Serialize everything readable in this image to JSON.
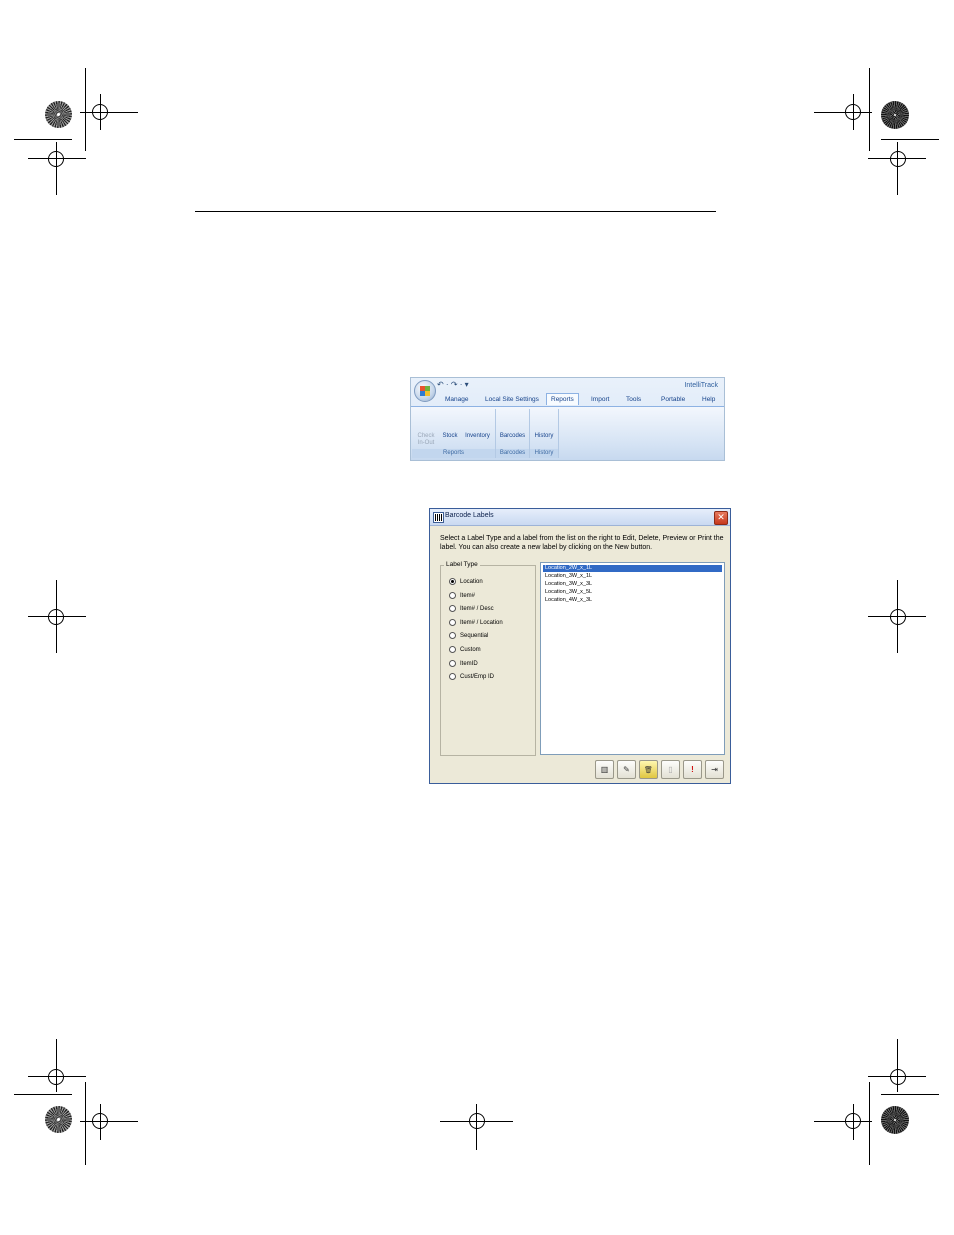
{
  "ribbon": {
    "app_title": "IntelliTrack",
    "quick_access": "↶ · ↷ · ▾",
    "tabs": [
      "Manage",
      "Local Site Settings",
      "Reports",
      "Import",
      "Tools",
      "Portable",
      "Help"
    ],
    "active_tab": "Reports",
    "groups": [
      {
        "label": "Reports",
        "buttons": [
          "Check In-Out",
          "Stock",
          "Inventory"
        ]
      },
      {
        "label": "Barcodes",
        "buttons": [
          "Barcodes"
        ]
      },
      {
        "label": "History",
        "buttons": [
          "History"
        ]
      }
    ]
  },
  "dialog": {
    "title": "Barcode Labels",
    "close": "✕",
    "instructions": "Select a Label Type and a label from the list on the right to Edit, Delete, Preview or Print the label. You can also create a new label by clicking on the New button.",
    "label_type_legend": "Label Type",
    "label_types": [
      "Location",
      "Item#",
      "Item# / Desc",
      "Item# / Location",
      "Sequential",
      "Custom",
      "ItemID",
      "Cust/Emp ID"
    ],
    "selected_type": "Location",
    "labels": [
      "Location_2W_x_1L",
      "Location_3W_x_1L",
      "Location_3W_x_3L",
      "Location_3W_x_5L",
      "Location_4W_x_3L"
    ],
    "selected_label": "Location_2W_x_1L",
    "toolbar": [
      {
        "icon": "new-label-icon",
        "glyph": "▥"
      },
      {
        "icon": "edit-label-icon",
        "glyph": "✎"
      },
      {
        "icon": "delete-label-icon",
        "glyph": "🗑"
      },
      {
        "icon": "preview-label-icon",
        "glyph": "▯"
      },
      {
        "icon": "print-label-icon",
        "glyph": "!"
      },
      {
        "icon": "exit-icon",
        "glyph": "⇥"
      }
    ]
  }
}
